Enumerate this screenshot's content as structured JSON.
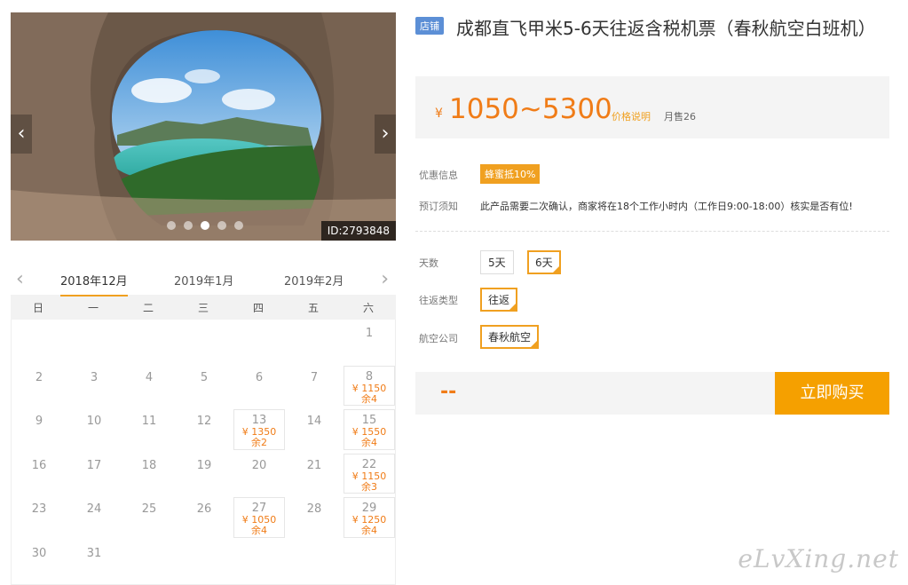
{
  "gallery": {
    "prev_icon": "‹",
    "next_icon": "›",
    "dots": [
      false,
      false,
      true,
      false,
      false
    ],
    "image_id": "ID:2793848"
  },
  "calendar": {
    "prev_icon": "‹",
    "next_icon": "›",
    "months": [
      {
        "label": "2018年12月",
        "active": true
      },
      {
        "label": "2019年1月",
        "active": false
      },
      {
        "label": "2019年2月",
        "active": false
      }
    ],
    "weekdays": [
      "日",
      "一",
      "二",
      "三",
      "四",
      "五",
      "六"
    ],
    "leading_blank": 6,
    "days": [
      {
        "d": "1"
      },
      {
        "d": "2"
      },
      {
        "d": "3"
      },
      {
        "d": "4"
      },
      {
        "d": "5"
      },
      {
        "d": "6"
      },
      {
        "d": "7"
      },
      {
        "d": "8",
        "price": "¥ 1150",
        "left": "余4"
      },
      {
        "d": "9"
      },
      {
        "d": "10"
      },
      {
        "d": "11"
      },
      {
        "d": "12"
      },
      {
        "d": "13",
        "price": "¥ 1350",
        "left": "余2"
      },
      {
        "d": "14"
      },
      {
        "d": "15",
        "price": "¥ 1550",
        "left": "余4"
      },
      {
        "d": "16"
      },
      {
        "d": "17"
      },
      {
        "d": "18"
      },
      {
        "d": "19"
      },
      {
        "d": "20"
      },
      {
        "d": "21"
      },
      {
        "d": "22",
        "price": "¥ 1150",
        "left": "余3"
      },
      {
        "d": "23"
      },
      {
        "d": "24"
      },
      {
        "d": "25"
      },
      {
        "d": "26"
      },
      {
        "d": "27",
        "price": "¥ 1050",
        "left": "余4"
      },
      {
        "d": "28"
      },
      {
        "d": "29",
        "price": "¥ 1250",
        "left": "余4"
      },
      {
        "d": "30"
      },
      {
        "d": "31"
      }
    ]
  },
  "product": {
    "shop_tag": "店铺",
    "title": "成都直飞甲米5-6天往返含税机票（春秋航空白班机）",
    "price_symbol": "¥",
    "price_range": "1050~5300",
    "price_note": "价格说明",
    "monthly_sales": "月售26"
  },
  "info": {
    "promo_label": "优惠信息",
    "promo_badge": "蜂蜜抵10%",
    "notice_label": "预订须知",
    "notice_text": "此产品需要二次确认，商家将在18个工作小时内（工作日9:00-18:00）核实是否有位!"
  },
  "options": {
    "days_label": "天数",
    "days_opt1": "5天",
    "days_opt2": "6天",
    "trip_label": "往返类型",
    "trip_opt": "往返",
    "airline_label": "航空公司",
    "airline_opt": "春秋航空"
  },
  "purchase": {
    "total": "--",
    "buy_label": "立即购买"
  },
  "watermark": "eLvXing.net",
  "colors": {
    "accent": "#f5a000",
    "price": "#f07c17",
    "shop_tag": "#5c8fd6"
  }
}
